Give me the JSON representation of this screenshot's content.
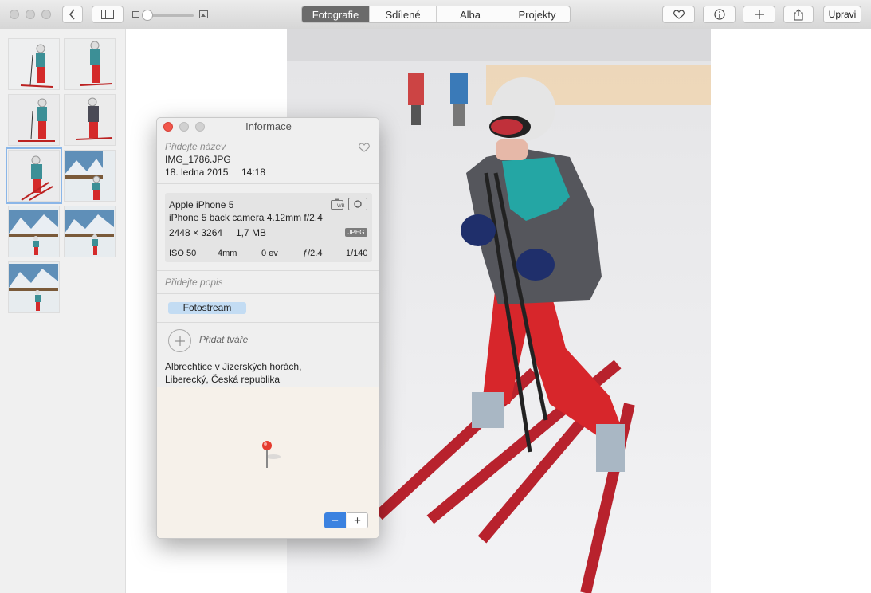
{
  "toolbar": {
    "tabs": [
      {
        "label": "Fotografie",
        "active": true
      },
      {
        "label": "Sdílené",
        "active": false
      },
      {
        "label": "Alba",
        "active": false
      },
      {
        "label": "Projekty",
        "active": false
      }
    ],
    "edit_label": "Upravi",
    "icons": [
      "back-chevron-icon",
      "sidebar-toggle-icon",
      "heart-icon",
      "info-icon",
      "add-icon",
      "share-icon"
    ]
  },
  "info": {
    "window_title": "Informace",
    "title_placeholder": "Přidejte název",
    "filename": "IMG_1786.JPG",
    "date": "18. ledna 2015",
    "time": "14:18",
    "camera_model": "Apple iPhone 5",
    "lens": "iPhone 5 back camera 4.12mm f/2.4",
    "dimensions": "2448 × 3264",
    "filesize": "1,7 MB",
    "format_badge": "JPEG",
    "wb_badge": "WB",
    "exif": {
      "iso": "ISO 50",
      "focal": "4mm",
      "ev": "0 ev",
      "aperture": "ƒ/2.4",
      "shutter": "1/140"
    },
    "description_placeholder": "Přidejte popis",
    "keyword": "Fotostream",
    "add_faces_label": "Přidat tváře",
    "location_line1": "Albrechtice v Jizerských horách,",
    "location_line2": "Liberecký, Česká republika"
  },
  "colors": {
    "accent": "#3b82e0",
    "tag_bg": "#c3dcf3",
    "close_red": "#f2574c"
  }
}
